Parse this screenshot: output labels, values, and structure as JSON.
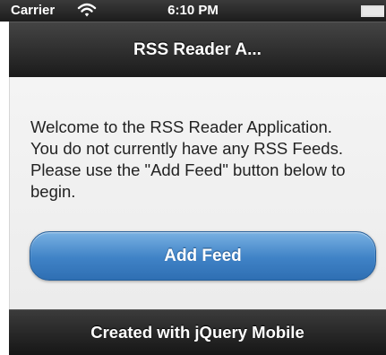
{
  "status_bar": {
    "carrier": "Carrier",
    "time": "6:10 PM",
    "signal_icon": "wifi-icon",
    "battery_icon": "battery-icon"
  },
  "header": {
    "title": "RSS Reader A..."
  },
  "content": {
    "welcome_text": "Welcome to the RSS Reader Application. You do not currently have any RSS Feeds. Please use the \"Add Feed\" button below to begin.",
    "add_feed_label": "Add Feed"
  },
  "footer": {
    "text": "Created with jQuery Mobile"
  },
  "colors": {
    "bar": "#2a2a2a",
    "content_bg": "#f0f0f0",
    "button": "#3f82c6"
  }
}
